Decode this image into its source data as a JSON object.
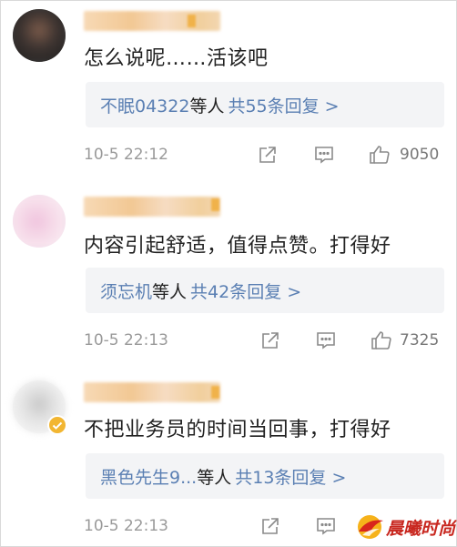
{
  "comments": [
    {
      "text": "怎么说呢……活该吧",
      "reply_users": "不眠04322",
      "reply_suffix": "等人",
      "reply_count": "共55条回复 >",
      "time": "10-5 22:12",
      "likes": "9050"
    },
    {
      "text": "内容引起舒适，值得点赞。打得好",
      "reply_users": "须忘机",
      "reply_suffix": "等人",
      "reply_count": "共42条回复 >",
      "time": "10-5 22:13",
      "likes": "7325"
    },
    {
      "text": "不把业务员的时间当回事，打得好",
      "reply_users": "黑色先生9...",
      "reply_suffix": "等人",
      "reply_count": "共13条回复 >",
      "time": "10-5 22:13",
      "likes": ""
    }
  ],
  "watermark": {
    "text": "晨曦时尚"
  },
  "icons": {
    "share": "share-icon",
    "comment": "comment-icon",
    "like": "thumbs-up-icon"
  },
  "colors": {
    "link": "#5a7fb3",
    "text": "#222222",
    "meta": "#9a9a9a",
    "reply_bg": "#f3f4f6"
  }
}
